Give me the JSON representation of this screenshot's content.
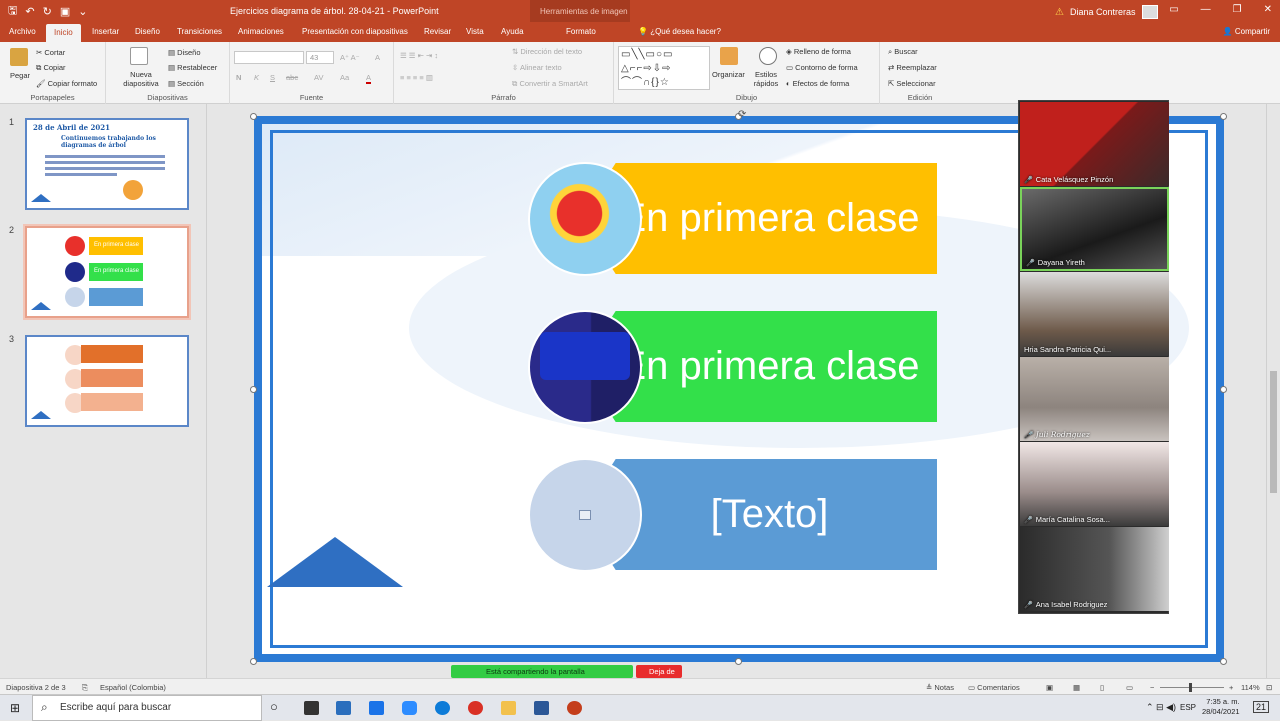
{
  "titlebar": {
    "qat_save": "🖫",
    "qat_undo": "↶",
    "qat_redo": "↻",
    "qat_present": "▣",
    "qat_more": "⌄",
    "document_title": "Ejercicios diagrama de árbol. 28-04-21  -  PowerPoint",
    "context_tools": "Herramientas de imagen",
    "warning_icon": "⚠",
    "user_name": "Diana Contreras",
    "window_controls": [
      "▭",
      "—",
      "❐",
      "✕"
    ]
  },
  "tabs": [
    "Archivo",
    "Inicio",
    "Insertar",
    "Diseño",
    "Transiciones",
    "Animaciones",
    "Presentación con diapositivas",
    "Revisar",
    "Vista",
    "Ayuda",
    "Formato"
  ],
  "active_tab": "Inicio",
  "tell_me": "¿Qué desea hacer?",
  "share": "Compartir",
  "ribbon": {
    "portapapeles": {
      "label": "Portapapeles",
      "paste": "Pegar",
      "cut": "Cortar",
      "copy": "Copiar",
      "format_painter": "Copiar formato"
    },
    "diapositivas": {
      "label": "Diapositivas",
      "new_slide": "Nueva diapositiva",
      "layout": "Diseño",
      "reset": "Restablecer",
      "section": "Sección"
    },
    "fuente": {
      "label": "Fuente",
      "size": "43",
      "bold": "N",
      "italic": "K",
      "underline": "S",
      "strike": "abc",
      "spacing": "AV",
      "case": "Aa",
      "color": "A"
    },
    "parrafo": {
      "label": "Párrafo",
      "direction": "Dirección del texto",
      "align": "Alinear texto",
      "smartart": "Convertir a SmartArt"
    },
    "dibujo": {
      "label": "Dibujo",
      "arrange": "Organizar",
      "styles": "Estilos rápidos",
      "fill": "Relleno de forma",
      "outline": "Contorno de forma",
      "effects": "Efectos de forma",
      "shapes_glyphs": "▭╲╲▭○▭ △⌐⌐⇨⇩⇨ ⌒⌒∩{}☆"
    },
    "edicion": {
      "label": "Edición",
      "find": "Buscar",
      "replace": "Reemplazar",
      "select": "Seleccionar"
    }
  },
  "thumbnails": [
    {
      "num": "1",
      "title": "28 de Abril de 2021",
      "subtitle": "Continuemos trabajando los diagramas de árbol"
    },
    {
      "num": "2",
      "items": [
        "En primera clase",
        "En primera clase",
        ""
      ]
    },
    {
      "num": "3"
    }
  ],
  "slide": {
    "items": [
      {
        "text": "En primera clase",
        "color": "#ffbf00"
      },
      {
        "text": "En primera clase",
        "color": "#33e04a"
      },
      {
        "text": "[Texto]",
        "color": "#5b9bd5"
      }
    ],
    "rotate_icon": "⟳"
  },
  "participants": [
    {
      "name": "Cata Velásquez Pinzón",
      "speaking": false
    },
    {
      "name": "Dayana Yireth",
      "speaking": true
    },
    {
      "name": "Hria Sandra Patricia Qui...",
      "speaking": false
    },
    {
      "name": "Juli Rodriguez",
      "speaking": false
    },
    {
      "name": "María Catalina Sosa...",
      "speaking": false
    },
    {
      "name": "Ana Isabel Rodriguez",
      "speaking": false
    }
  ],
  "sharing": {
    "status": "Está compartiendo la pantalla",
    "stop": "Deja de"
  },
  "statusbar": {
    "slide_info": "Diapositiva 2 de 3",
    "language": "Español (Colombia)",
    "notes": "Notas",
    "comments": "Comentarios",
    "zoom": "114%"
  },
  "taskbar": {
    "search_placeholder": "Escribe aquí para buscar",
    "language": "ESP",
    "time": "7:35 a. m.",
    "date": "28/04/2021",
    "notifications": "21"
  }
}
